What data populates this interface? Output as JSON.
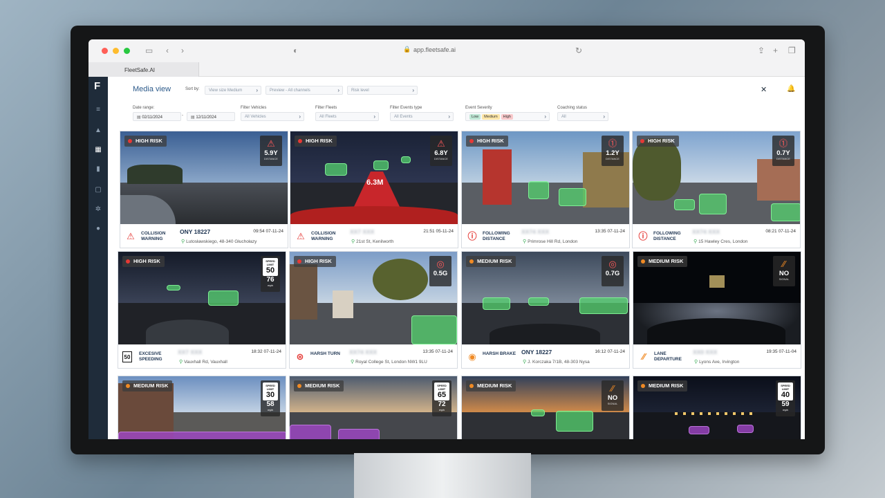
{
  "browser": {
    "url": "app.fleetsafe.ai",
    "tab_title": "FleetSafe.AI"
  },
  "app": {
    "logo": "F",
    "page_title": "Media view",
    "sort_label": "Sort by:",
    "sort_options": [
      "View size Medium",
      "Preview - All channels",
      "Risk level"
    ],
    "filters": {
      "date_range_label": "Date range:",
      "date_from": "02/11/2024",
      "date_sep": "-",
      "date_to": "12/11/2024",
      "vehicles_label": "Filter Vehicles",
      "vehicles_value": "All Vehicles",
      "fleets_label": "Filter Fleets",
      "fleets_value": "All Fleets",
      "events_label": "Filter Events type",
      "events_value": "All Events",
      "severity_label": "Event Severity",
      "severity_pills": [
        "Low",
        "Medium",
        "High"
      ],
      "coaching_label": "Coaching status",
      "coaching_value": "All"
    }
  },
  "cards": [
    {
      "risk": "HIGH RISK",
      "metric_value": "5.9Y",
      "metric_sub": "DISTANCE",
      "event": "COLLISION WARNING",
      "plate": "ONY 18227",
      "time": "09:54 07-11-24",
      "location": "Lutosławskiego, 48-340 Głuchołazy"
    },
    {
      "risk": "HIGH RISK",
      "metric_value": "6.8Y",
      "metric_sub": "DISTANCE",
      "event": "COLLISION WARNING",
      "plate": "XX7 XXX",
      "time": "21:51 05-11-24",
      "location": "21st St, Kenilworth",
      "road_text": "6.3M"
    },
    {
      "risk": "HIGH RISK",
      "metric_value": "1.2Y",
      "metric_sub": "DISTANCE",
      "event": "FOLLOWING DISTANCE",
      "plate": "XX74 XXX",
      "time": "13:35 07-11-24",
      "location": "Primrose Hill Rd, London"
    },
    {
      "risk": "HIGH RISK",
      "metric_value": "0.7Y",
      "metric_sub": "DISTANCE",
      "event": "FOLLOWING DISTANCE",
      "plate": "XX74 XXX",
      "time": "08:21 07-11-24",
      "location": "15 Hawley Cres, London"
    },
    {
      "risk": "HIGH RISK",
      "sign_text": "SPEED LIMIT",
      "sign_value": "50",
      "speed_value": "76",
      "speed_unit": "mph",
      "event": "EXCESIVE SPEEDING",
      "event_sign": "50",
      "plate": "XX7 XXX",
      "time": "18:32 07-11-24",
      "location": "Vauxhall Rd, Vauxhall"
    },
    {
      "risk": "HIGH RISK",
      "metric_value": "0.5G",
      "event": "HARSH TURN",
      "plate": "XX74 XXX",
      "time": "13:35 07-11-24",
      "location": "Royal College St, London NW1 9LU"
    },
    {
      "risk": "MEDIUM RISK",
      "metric_value": "0.7G",
      "event": "HARSH BRAKE",
      "plate": "ONY 18227",
      "time": "16:12 07-11-24",
      "location": "J. Korczaka 7/1B, 48-303 Nysa"
    },
    {
      "risk": "MEDIUM RISK",
      "metric_value": "NO",
      "metric_sub": "SIGNAL",
      "event": "LANE DEPARTURE",
      "plate": "XX0 XXX",
      "time": "19:35 07-11-04",
      "location": "Lyons Ave, Irvington"
    },
    {
      "risk": "MEDIUM RISK",
      "sign_text": "SPEED LIMIT",
      "sign_value": "30",
      "speed_value": "58",
      "speed_unit": "mph"
    },
    {
      "risk": "MEDIUM RISK",
      "sign_text": "SPEED LIMIT",
      "sign_value": "65",
      "speed_value": "72",
      "speed_unit": "mph"
    },
    {
      "risk": "MEDIUM RISK",
      "metric_value": "NO",
      "metric_sub": "SIGNAL"
    },
    {
      "risk": "MEDIUM RISK",
      "sign_text": "SPEED LIMIT",
      "sign_value": "40",
      "speed_value": "59",
      "speed_unit": "mph"
    }
  ],
  "colors": {
    "high_risk_dot": "#e53935",
    "medium_risk_dot": "#f08a24",
    "sidebar": "#1f2c3a",
    "accent": "#2c5a8a",
    "detection_overlay": "#54d26e"
  }
}
